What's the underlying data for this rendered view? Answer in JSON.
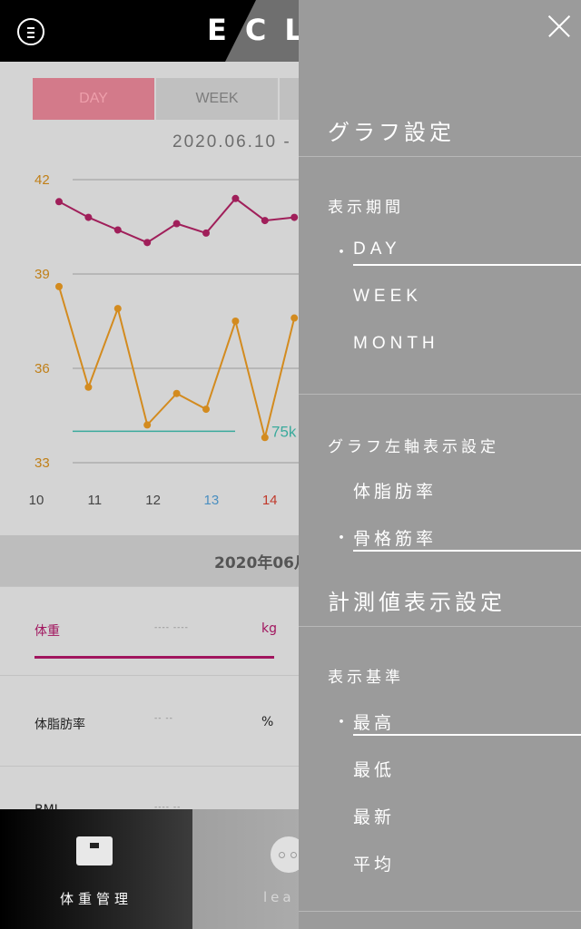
{
  "app": {
    "logo": "ECL",
    "period_tabs": [
      "DAY",
      "WEEK"
    ],
    "date_range": "2020.06.10 -",
    "date_header": "2020年06月",
    "metrics": [
      {
        "label": "体重",
        "value": "---- ----",
        "unit": "kg"
      },
      {
        "label": "体脂肪率",
        "value": "-- --",
        "unit": "%"
      },
      {
        "label": "BMI",
        "value": "---- --"
      }
    ],
    "nav": {
      "weight_label": "体重管理",
      "second_label": "lea"
    }
  },
  "chart_data": {
    "type": "line",
    "x_labels": [
      "10",
      "11",
      "12",
      "13",
      "14"
    ],
    "x_label_colors": [
      "#444444",
      "#444444",
      "#444444",
      "#4a8fc0",
      "#c0392b"
    ],
    "y_ticks": [
      "42",
      "39",
      "36",
      "33"
    ],
    "ylim": [
      33,
      42
    ],
    "target_label": "75k",
    "colors": {
      "series_1": "#a01f5a",
      "series_2": "#d38b1f",
      "target_line": "#3aaa9c"
    },
    "series": [
      {
        "values": [
          41.3,
          40.8,
          40.4,
          40.0,
          40.6,
          40.3,
          41.4,
          40.7,
          40.8
        ]
      },
      {
        "values": [
          38.6,
          35.4,
          37.9,
          34.2,
          35.2,
          34.7,
          37.5,
          33.8,
          37.6
        ]
      }
    ]
  },
  "drawer": {
    "graph_settings_title": "グラフ設定",
    "period_title": "表示期間",
    "period_options": [
      "DAY",
      "WEEK",
      "MONTH"
    ],
    "period_selected": "DAY",
    "left_axis_title": "グラフ左軸表示設定",
    "left_axis_options": [
      "体脂肪率",
      "骨格筋率"
    ],
    "left_axis_selected": "骨格筋率",
    "measure_title": "計測値表示設定",
    "basis_title": "表示基準",
    "basis_options": [
      "最高",
      "最低",
      "最新",
      "平均"
    ],
    "basis_selected": "最高",
    "bullet": "・"
  }
}
